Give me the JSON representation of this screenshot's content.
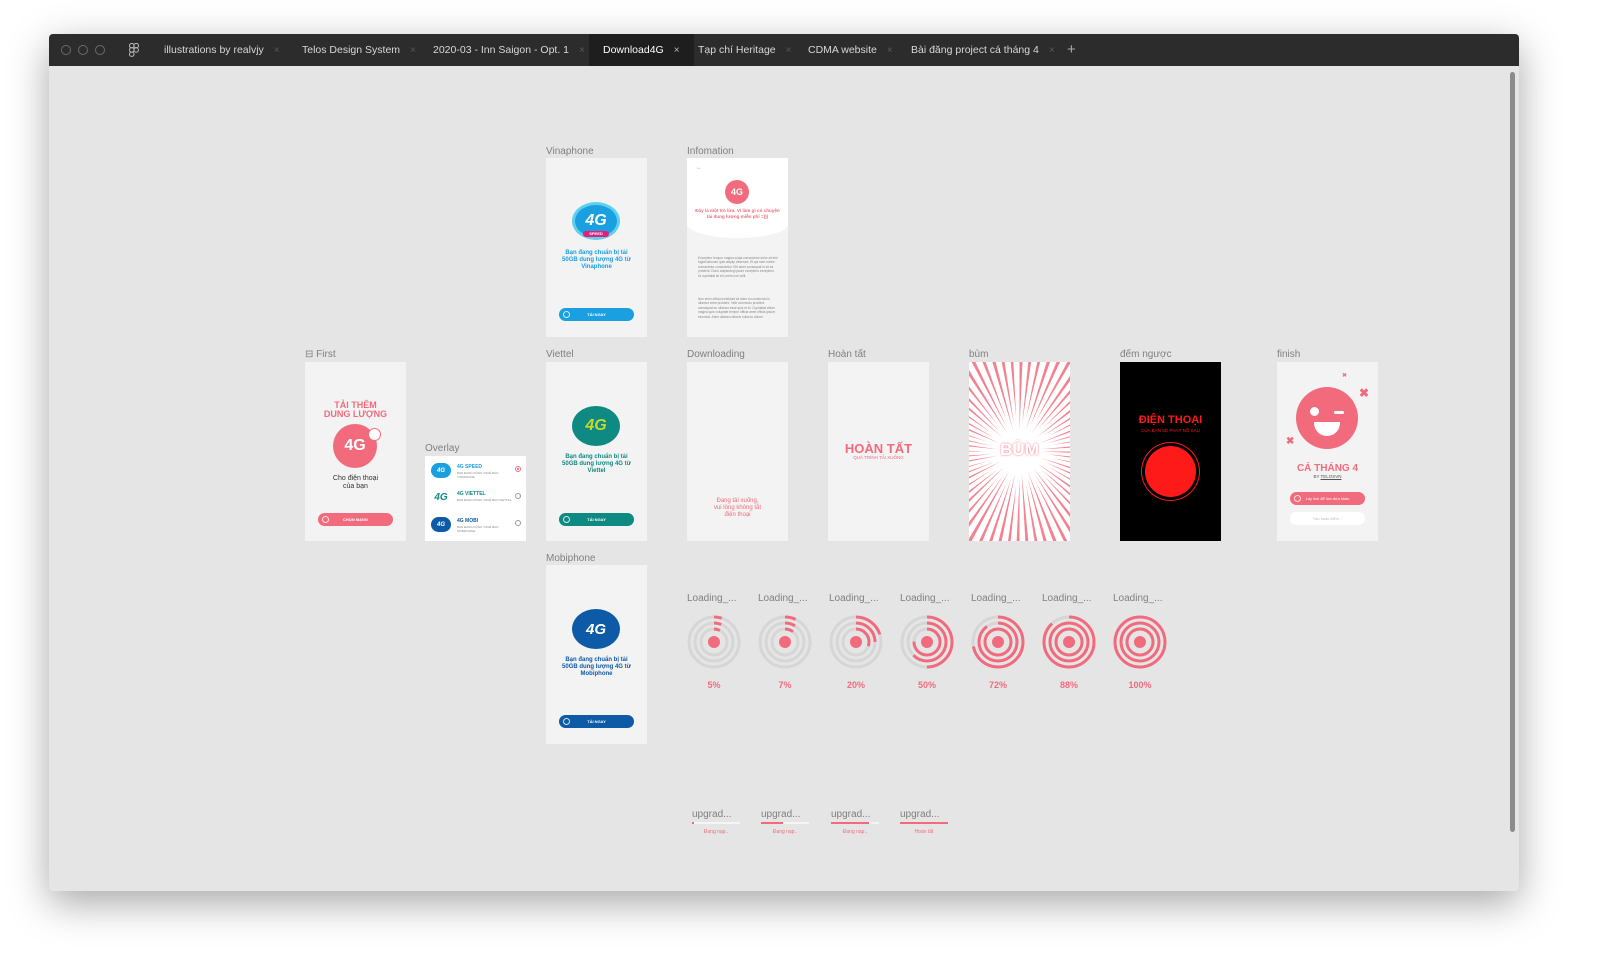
{
  "tabs": [
    {
      "label": "illustrations by realvjy",
      "active": false
    },
    {
      "label": "Telos Design System",
      "active": false
    },
    {
      "label": "2020-03 - Inn Saigon - Opt. 1",
      "active": false
    },
    {
      "label": "Download4G",
      "active": true
    },
    {
      "label": "Tạp chí Heritage",
      "active": false
    },
    {
      "label": "CDMA website",
      "active": false
    },
    {
      "label": "Bài đăng project cá tháng 4",
      "active": false
    }
  ],
  "icons": {
    "close": "×",
    "add": "+"
  },
  "labels": {
    "vinaphone": "Vinaphone",
    "information": "Infomation",
    "first": "⊟ First",
    "overlay": "Overlay",
    "viettel": "Viettel",
    "downloading": "Downloading",
    "done": "Hoàn tất",
    "bum": "bùm",
    "countdown": "đếm ngược",
    "finish": "finish",
    "mobiphone": "Mobiphone"
  },
  "vinaphone": {
    "logo": "4G",
    "badge": "SPEED",
    "text": "Bạn đang chuẩn bị tải 50GB dung lượng 4G từ Vinaphone",
    "button": "TẢI NGAY"
  },
  "viettel": {
    "logo": "4G",
    "text": "Bạn đang chuẩn bị tải 50GB dung lượng 4G từ Viettel",
    "button": "TẢI NGAY"
  },
  "mobiphone": {
    "logo": "4G",
    "text": "Bạn đang chuẩn bị tải 50GB dung lượng 4G từ Mobiphone",
    "button": "TẢI NGAY"
  },
  "info": {
    "back": "←",
    "logo": "4G",
    "heading": "Đây là một trò lừa. Vì làm gì có chuyện tải dung lượng miễn phí =)))",
    "body1": "Excepteur tempor magna culpa consectetur dolor sit sint fugiat laborum quis aliquip deserunt. Et qui nam minim consectetur consectetur. Elit amet consequat in sit ea proident. Dolor adipisicing ipsum excepteur excepteur. Ut cupidatat sit et Lorem non velit.",
    "body2": "Non enim officia incididunt sit dolor eu commodo in ullamco enim proident. Velit commodo proident consequat eu ullamco esse quis et et. Cupidatat cillum magna quis voluptate tempor officia amet officia ipsum eiusmod. Anim ullamco laboris nulla do dolore."
  },
  "first": {
    "title1": "TẢI THÊM",
    "title2": "DUNG LƯỢNG",
    "logo": "4G",
    "subtitle1": "Cho điện thoại",
    "subtitle2": "của bạn",
    "button": "CHỌN MẠNG"
  },
  "overlay": {
    "rows": [
      {
        "logo": "4G",
        "title": "4G SPEED",
        "sub": "BẠN ĐANG DÙNG THUÊ BAO VINAPHONE"
      },
      {
        "logo": "4G",
        "title": "4G VIETTEL",
        "sub": "BẠN ĐANG DÙNG THUÊ BAO VIETTEL"
      },
      {
        "logo": "4G",
        "title": "4G MOBI",
        "sub": "BẠN ĐANG DÙNG THUÊ BAO MOBIPHONE"
      }
    ]
  },
  "downloading": {
    "text1": "Đang tải xuống,",
    "text2": "vui lòng không tắt",
    "text3": "điện thoại"
  },
  "done": {
    "title": "HOÀN TẤT",
    "sub": "QUÁ TRÌNH TẢI XUỐNG"
  },
  "bum": {
    "text": "BÙM"
  },
  "countdown": {
    "title": "ĐIỆN THOẠI",
    "sub": "CỦA BẠN SẼ PHÁT NỔ SAU"
  },
  "finish": {
    "title": "CÁ THÁNG 4",
    "by": "BY",
    "author": "TELOSVN",
    "button": "Lấy link để lừa đứa khác",
    "button2": "Tạo hoặc kiểm..."
  },
  "loading": {
    "label": "Loading_...",
    "items": [
      {
        "pct": "5%",
        "value": 0.05
      },
      {
        "pct": "7%",
        "value": 0.07
      },
      {
        "pct": "20%",
        "value": 0.2
      },
      {
        "pct": "50%",
        "value": 0.5
      },
      {
        "pct": "72%",
        "value": 0.72
      },
      {
        "pct": "88%",
        "value": 0.88
      },
      {
        "pct": "100%",
        "value": 1.0
      }
    ]
  },
  "upgrade": {
    "label": "upgrad...",
    "items": [
      {
        "text": "Đang nạp..",
        "value": 0.05
      },
      {
        "text": "Đang nạp..",
        "value": 0.45
      },
      {
        "text": "Đang nạp..",
        "value": 0.8
      },
      {
        "text": "Hoàn tất",
        "value": 1.0
      }
    ]
  },
  "colors": {
    "pink": "#f26b7d",
    "vina": "#1a9fe0",
    "viettel": "#0e8a82",
    "mobi": "#0d5aa7",
    "red": "#ff1a1a"
  }
}
